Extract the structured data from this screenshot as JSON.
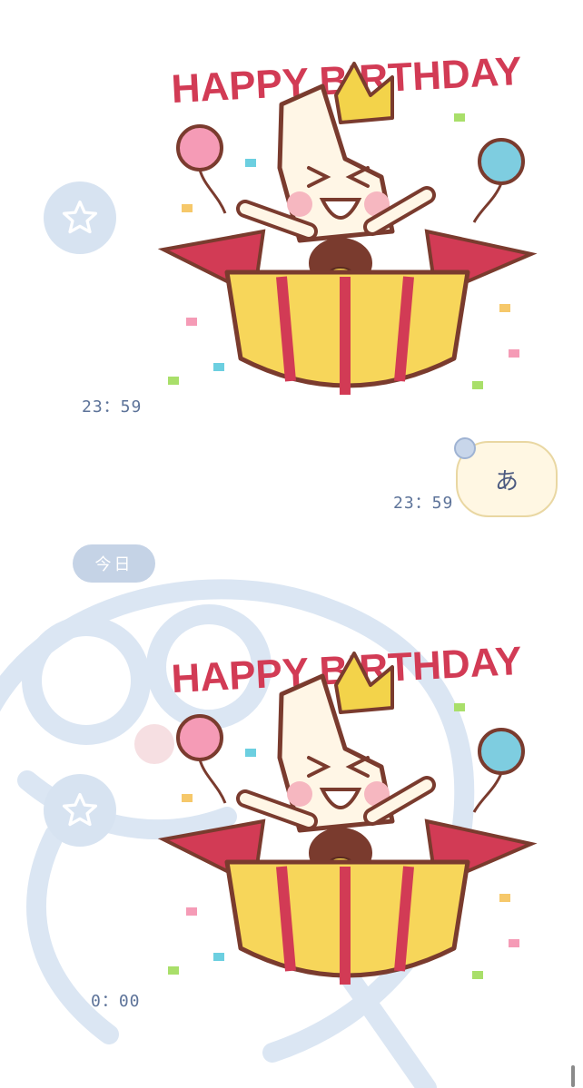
{
  "messages": [
    {
      "type": "sticker",
      "side": "left",
      "time": "23：59",
      "sticker_text": "HAPPY BIRTHDAY"
    },
    {
      "type": "text",
      "side": "right",
      "time": "23：59",
      "text": "あ"
    },
    {
      "type": "date_separator",
      "text": "今日"
    },
    {
      "type": "sticker",
      "side": "left",
      "time": "0：00",
      "sticker_text": "HAPPY BIRTHDAY"
    }
  ],
  "icons": {
    "avatar": "star-icon"
  },
  "colors": {
    "avatar_bg": "#d7e3f1",
    "bubble_bg": "#fff7e3",
    "date_pill_bg": "#c5d3e6",
    "time_text": "#5d7399",
    "sticker_title": "#d23b55"
  }
}
